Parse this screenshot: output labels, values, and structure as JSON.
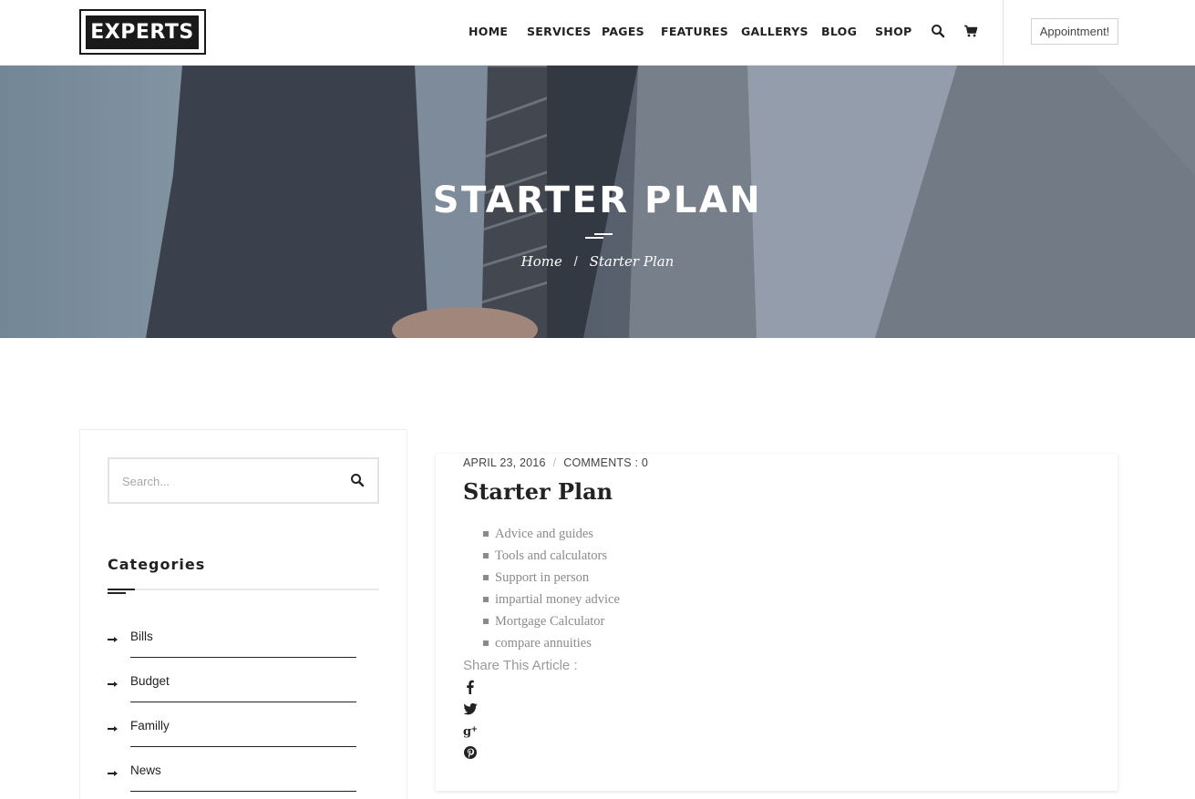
{
  "header": {
    "logo_text": "EXPERTS",
    "nav": [
      "HOME",
      "SERVICES",
      "PAGES",
      "FEATURES",
      "GALLERYS",
      "BLOG",
      "SHOP"
    ],
    "icons": [
      "search-icon",
      "cart-icon"
    ],
    "appointment_label": "Appointment!"
  },
  "hero": {
    "title": "STARTER PLAN",
    "breadcrumb": {
      "home": "Home",
      "separator": "/",
      "current": "Starter Plan"
    }
  },
  "sidebar": {
    "search_placeholder": "Search...",
    "categories_title": "Categories",
    "categories": [
      "Bills",
      "Budget",
      "Familly",
      "News"
    ]
  },
  "article": {
    "date": "APRIL 23, 2016",
    "meta_separator": "/",
    "comments": "COMMENTS : 0",
    "title": "Starter Plan",
    "features": [
      "Advice and guides",
      "Tools and calculators",
      "Support in person",
      "impartial money advice",
      "Mortgage Calculator",
      "compare annuities"
    ],
    "share_label": "Share This Article :",
    "share_icons": [
      "facebook-icon",
      "twitter-icon",
      "google-plus-icon",
      "pinterest-icon"
    ]
  },
  "colors": {
    "text_dark": "#222222",
    "text_muted": "#8a8a8a",
    "logo_bg": "#1a1a1a",
    "hero_overlay": "#6b7684"
  }
}
